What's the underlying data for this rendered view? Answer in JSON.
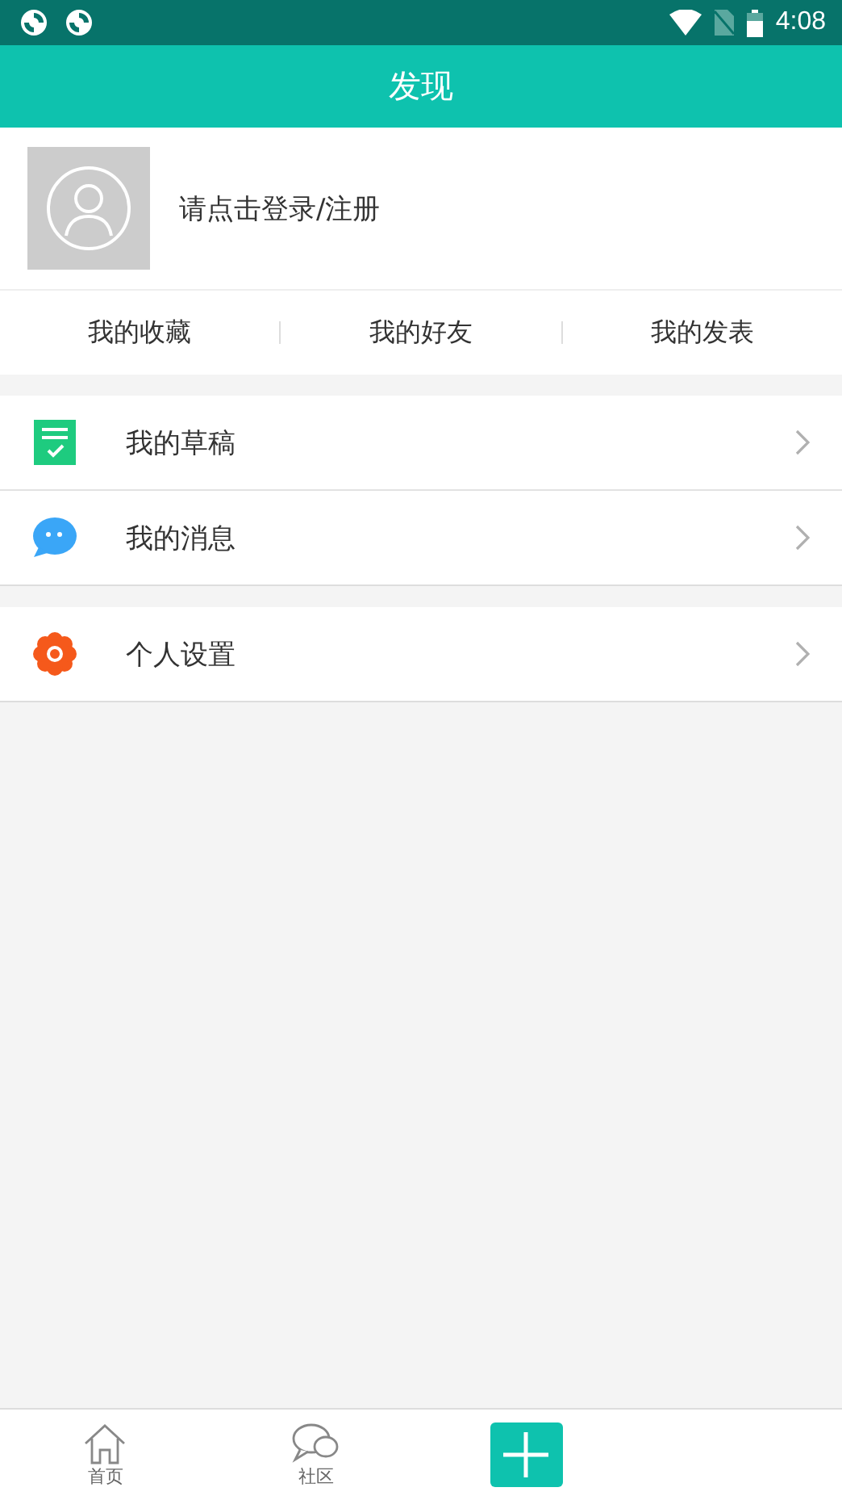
{
  "status_bar": {
    "time": "4:08"
  },
  "header": {
    "title": "发现"
  },
  "profile": {
    "login_prompt": "请点击登录/注册"
  },
  "shortcuts": [
    "我的收藏",
    "我的好友",
    "我的发表"
  ],
  "menu_groups": [
    {
      "items": [
        {
          "kind": "draft",
          "label": "我的草稿"
        },
        {
          "kind": "message",
          "label": "我的消息"
        }
      ]
    },
    {
      "items": [
        {
          "kind": "settings",
          "label": "个人设置"
        }
      ]
    }
  ],
  "bottom_nav": [
    {
      "kind": "home",
      "label": "首页"
    },
    {
      "kind": "community",
      "label": "社区"
    },
    {
      "kind": "add"
    }
  ]
}
